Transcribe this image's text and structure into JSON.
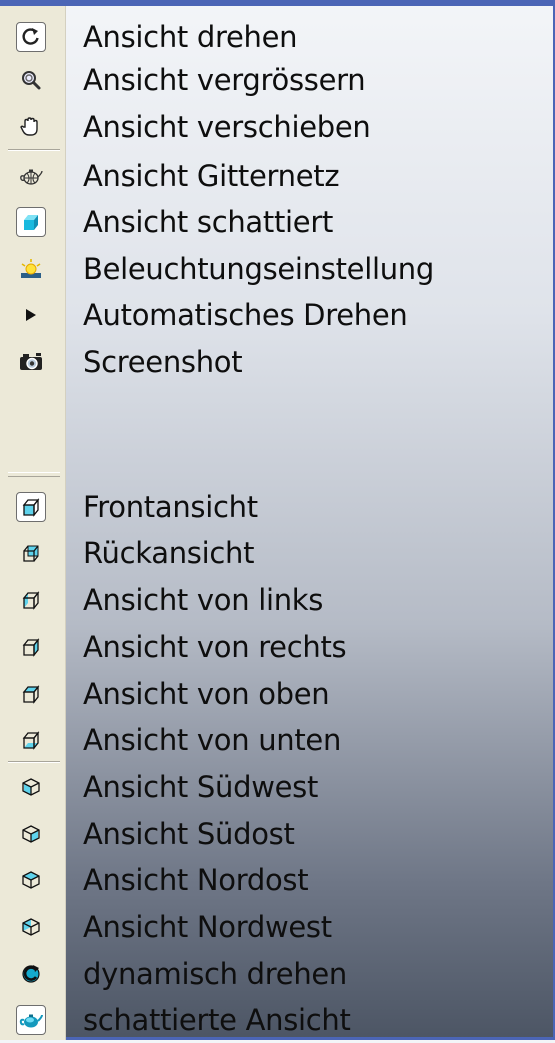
{
  "group1": {
    "items": [
      {
        "label": "Ansicht drehen",
        "icon": "rotate-icon",
        "pressed": true
      },
      {
        "label": "Ansicht vergrössern",
        "icon": "zoom-icon",
        "pressed": false
      },
      {
        "label": "Ansicht verschieben",
        "icon": "pan-hand-icon",
        "pressed": false
      },
      {
        "label": "Ansicht Gitternetz",
        "icon": "wireframe-teapot-icon",
        "pressed": false
      },
      {
        "label": "Ansicht schattiert",
        "icon": "shaded-cube-icon",
        "pressed": true
      },
      {
        "label": "Beleuchtungseinstellung",
        "icon": "lighting-icon",
        "pressed": false
      },
      {
        "label": "Automatisches Drehen",
        "icon": "play-icon",
        "pressed": false
      },
      {
        "label": "Screenshot",
        "icon": "camera-icon",
        "pressed": false
      }
    ]
  },
  "group2": {
    "items": [
      {
        "label": "Frontansicht",
        "icon": "cube-front-icon",
        "pressed": true
      },
      {
        "label": "Rückansicht",
        "icon": "cube-back-icon",
        "pressed": false
      },
      {
        "label": "Ansicht von links",
        "icon": "cube-left-icon",
        "pressed": false
      },
      {
        "label": "Ansicht von rechts",
        "icon": "cube-right-icon",
        "pressed": false
      },
      {
        "label": "Ansicht von oben",
        "icon": "cube-top-icon",
        "pressed": false
      },
      {
        "label": "Ansicht von unten",
        "icon": "cube-bottom-icon",
        "pressed": false
      },
      {
        "label": "Ansicht Südwest",
        "icon": "iso-southwest-icon",
        "pressed": false
      },
      {
        "label": "Ansicht Südost",
        "icon": "iso-southeast-icon",
        "pressed": false
      },
      {
        "label": "Ansicht Nordost",
        "icon": "iso-northeast-icon",
        "pressed": false
      },
      {
        "label": "Ansicht Nordwest",
        "icon": "iso-northwest-icon",
        "pressed": false
      },
      {
        "label": "dynamisch drehen",
        "icon": "dynamic-rotate-icon",
        "pressed": false
      },
      {
        "label": "schattierte Ansicht",
        "icon": "shaded-teapot-icon",
        "pressed": true
      }
    ]
  },
  "colors": {
    "frame": "#4b65b6",
    "toolbar": "#ece9d8",
    "accent": "#1fb6d6"
  }
}
